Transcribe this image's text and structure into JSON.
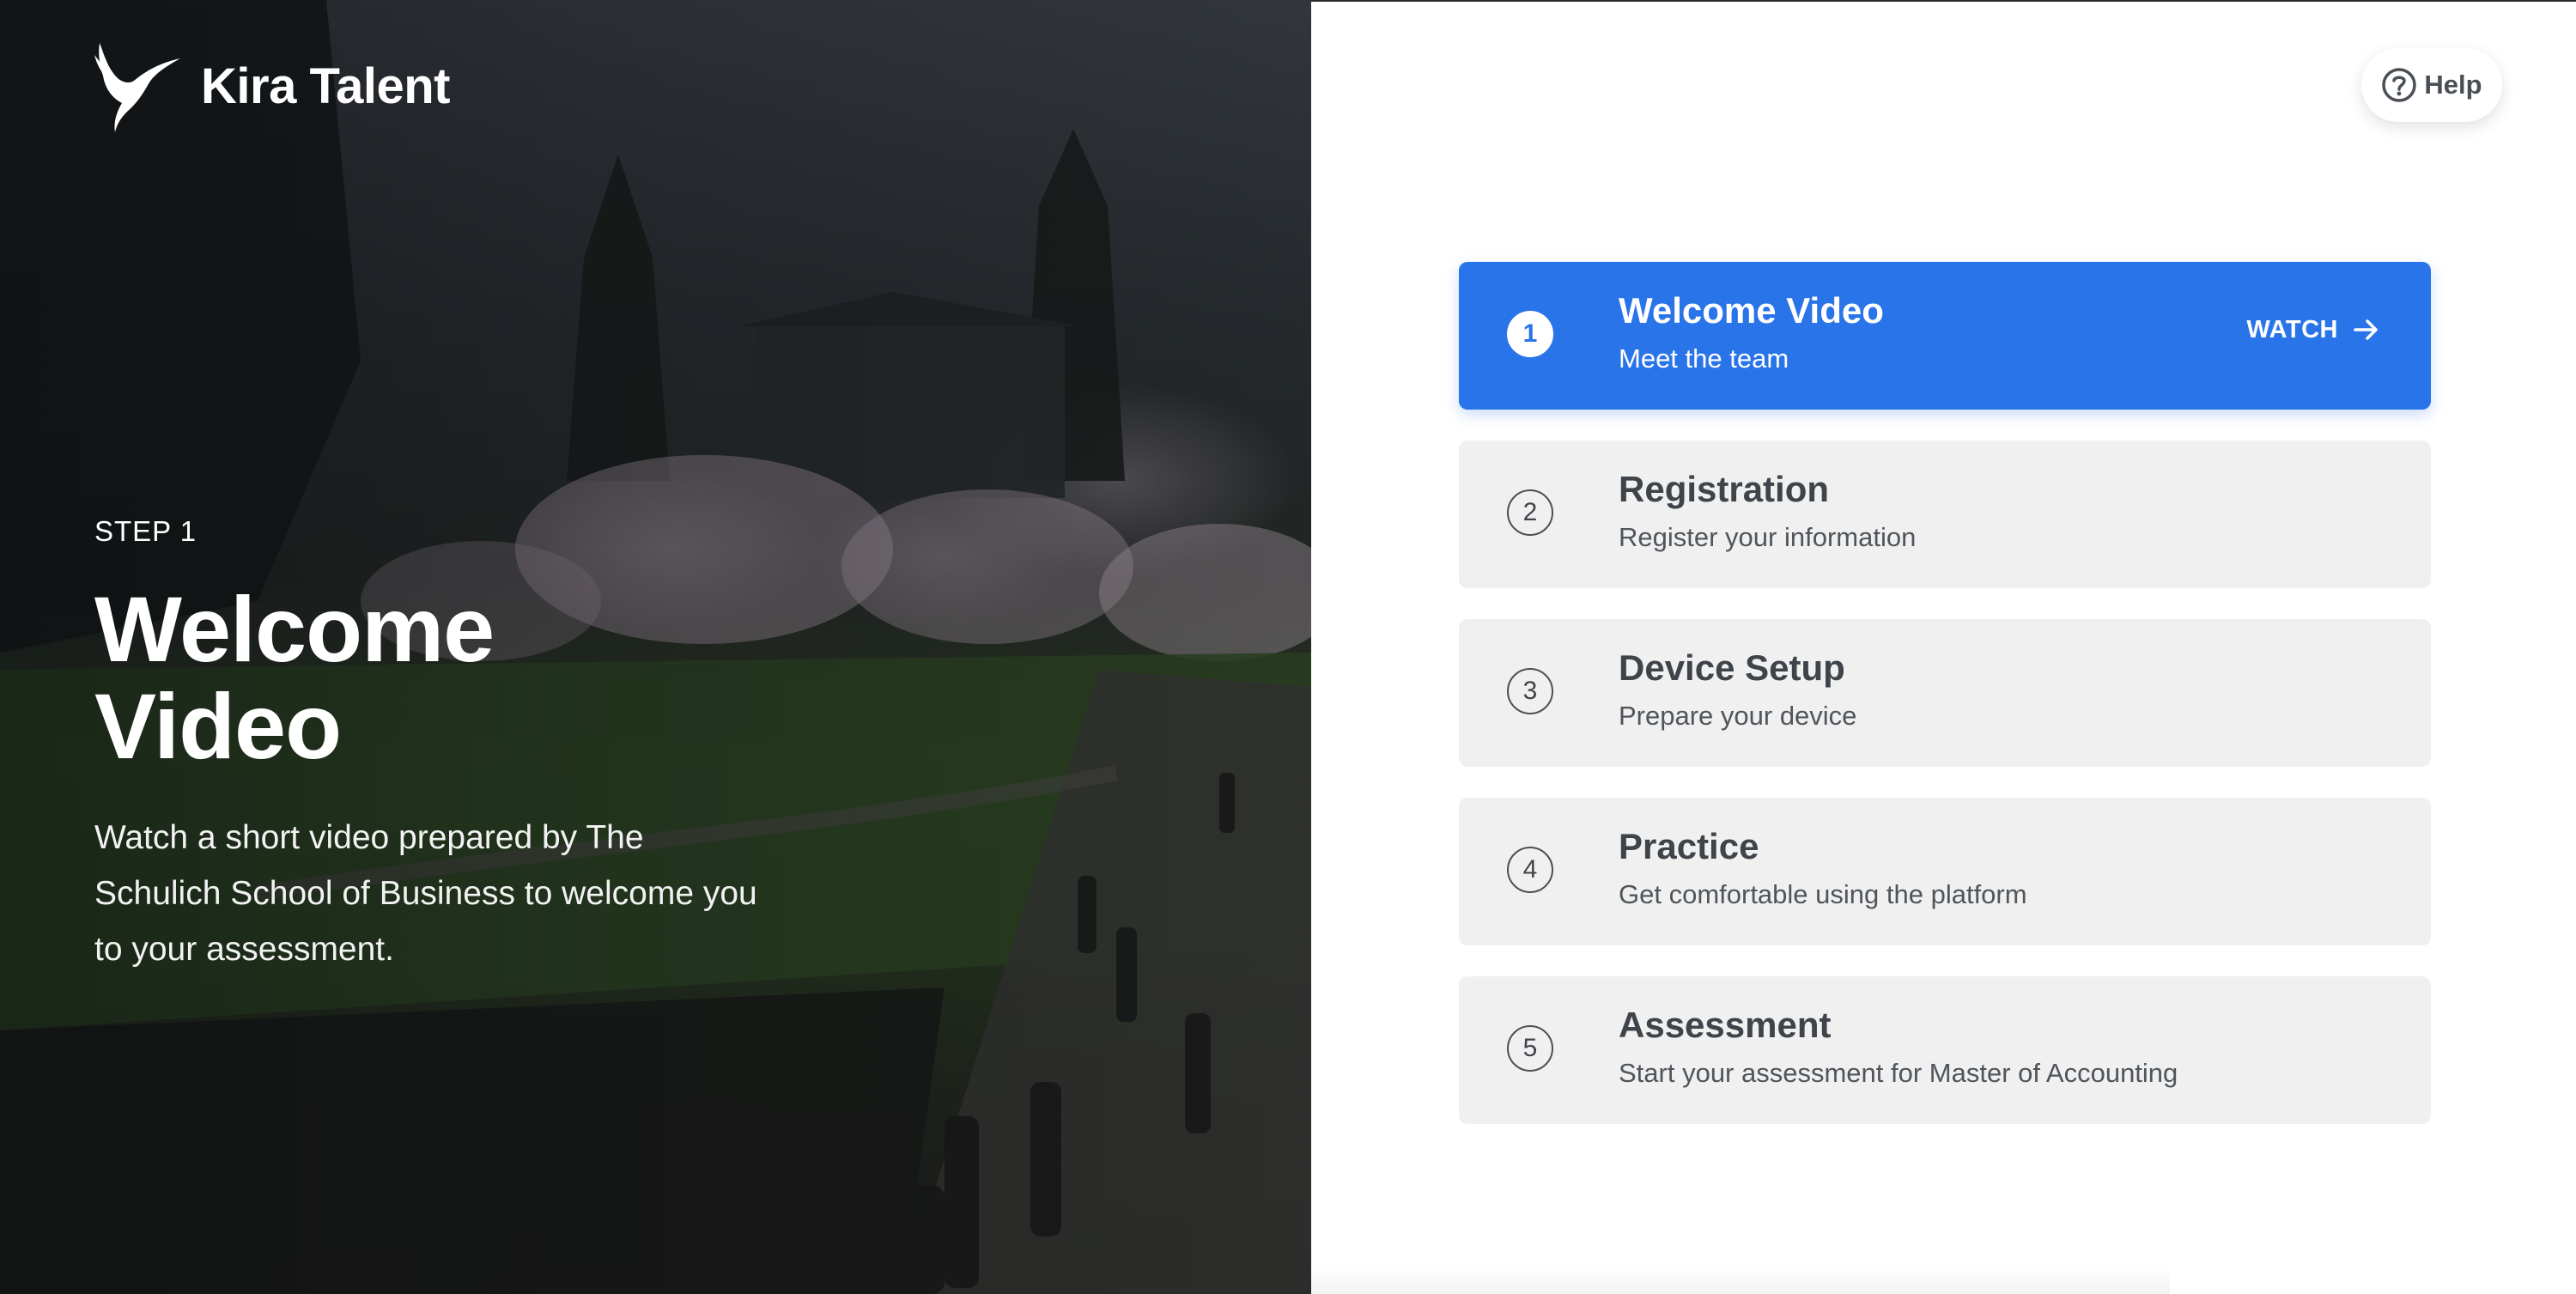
{
  "brand": {
    "name": "Kira Talent"
  },
  "hero": {
    "step_label": "STEP 1",
    "title": "Welcome Video",
    "description": "Watch a short video prepared by The Schulich School of Business to welcome you to your assessment."
  },
  "help": {
    "label": "Help",
    "icon": "question-circle-icon"
  },
  "steps": [
    {
      "number": "1",
      "title": "Welcome Video",
      "subtitle": "Meet the team",
      "active": true,
      "action": "WATCH"
    },
    {
      "number": "2",
      "title": "Registration",
      "subtitle": "Register your information",
      "active": false
    },
    {
      "number": "3",
      "title": "Device Setup",
      "subtitle": "Prepare your device",
      "active": false
    },
    {
      "number": "4",
      "title": "Practice",
      "subtitle": "Get comfortable using the platform",
      "active": false
    },
    {
      "number": "5",
      "title": "Assessment",
      "subtitle": "Start your assessment for Master of Accounting",
      "active": false
    }
  ],
  "colors": {
    "accent": "#2a74ea",
    "card_bg": "#eff0ef",
    "text_dark": "#3f444a"
  }
}
